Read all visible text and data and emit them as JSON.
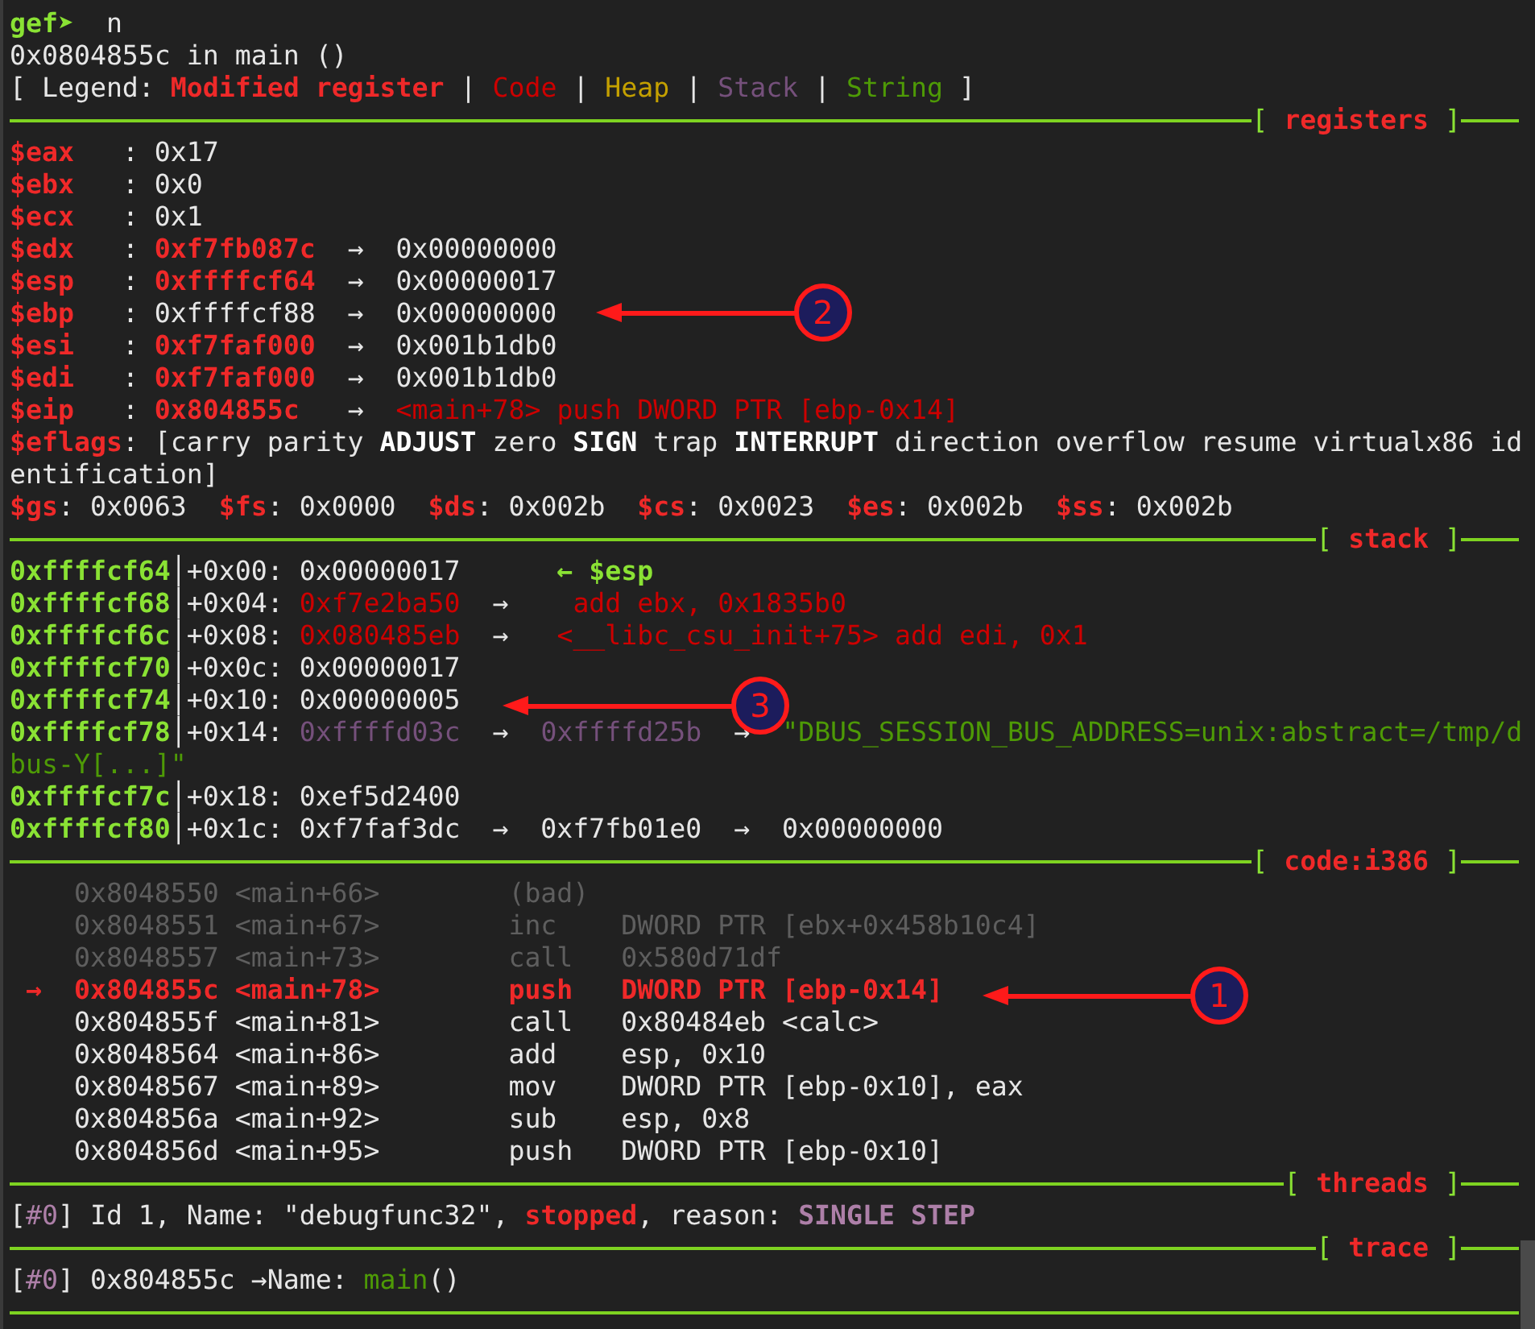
{
  "lines": [
    {
      "kind": "text",
      "segments": [
        {
          "text": "gef➤",
          "kind": "prompt"
        },
        {
          "text": "  n",
          "kind": "plain"
        }
      ]
    },
    {
      "kind": "text",
      "segments": [
        {
          "text": "0x0804855c in main ()",
          "kind": "plain"
        }
      ]
    },
    {
      "kind": "text",
      "segments": [
        {
          "text": "[ Legend:",
          "kind": "plain"
        },
        {
          "text": " Modified register",
          "kind": "mod"
        },
        {
          "text": " |",
          "kind": "plain"
        },
        {
          "text": " Code",
          "kind": "code"
        },
        {
          "text": " |",
          "kind": "plain"
        },
        {
          "text": " Heap",
          "kind": "heap"
        },
        {
          "text": " |",
          "kind": "plain"
        },
        {
          "text": " Stack",
          "kind": "stack"
        },
        {
          "text": " |",
          "kind": "plain"
        },
        {
          "text": " String",
          "kind": "string"
        },
        {
          "text": " ]",
          "kind": "plain"
        }
      ]
    },
    {
      "kind": "separator",
      "segments": [
        {
          "text": "[ ",
          "kind": "bracket"
        },
        {
          "text": "registers",
          "kind": "title"
        },
        {
          "text": " ]",
          "kind": "bracket"
        }
      ]
    },
    {
      "kind": "text",
      "segments": [
        {
          "text": "$eax",
          "kind": "mod"
        },
        {
          "text": "   : 0x17",
          "kind": "plain"
        }
      ]
    },
    {
      "kind": "text",
      "segments": [
        {
          "text": "$ebx",
          "kind": "mod"
        },
        {
          "text": "   : 0x0",
          "kind": "plain"
        }
      ]
    },
    {
      "kind": "text",
      "segments": [
        {
          "text": "$ecx",
          "kind": "mod"
        },
        {
          "text": "   : 0x1",
          "kind": "plain"
        }
      ]
    },
    {
      "kind": "text",
      "segments": [
        {
          "text": "$edx",
          "kind": "mod"
        },
        {
          "text": "   :",
          "kind": "plain"
        },
        {
          "text": " 0xf7fb087c",
          "kind": "mod"
        },
        {
          "text": "  →  0x00000000",
          "kind": "plain"
        }
      ]
    },
    {
      "kind": "text",
      "segments": [
        {
          "text": "$esp",
          "kind": "mod"
        },
        {
          "text": "   :",
          "kind": "plain"
        },
        {
          "text": " 0xffffcf64",
          "kind": "mod"
        },
        {
          "text": "  →  0x00000017",
          "kind": "plain"
        }
      ]
    },
    {
      "kind": "text",
      "segments": [
        {
          "text": "$ebp",
          "kind": "mod"
        },
        {
          "text": "   : 0xffffcf88  →  0x00000000",
          "kind": "plain"
        }
      ]
    },
    {
      "kind": "text",
      "segments": [
        {
          "text": "$esi",
          "kind": "mod"
        },
        {
          "text": "   :",
          "kind": "plain"
        },
        {
          "text": " 0xf7faf000",
          "kind": "mod"
        },
        {
          "text": "  →  0x001b1db0",
          "kind": "plain"
        }
      ]
    },
    {
      "kind": "text",
      "segments": [
        {
          "text": "$edi",
          "kind": "mod"
        },
        {
          "text": "   :",
          "kind": "plain"
        },
        {
          "text": " 0xf7faf000",
          "kind": "mod"
        },
        {
          "text": "  →  0x001b1db0",
          "kind": "plain"
        }
      ]
    },
    {
      "kind": "text",
      "segments": [
        {
          "text": "$eip",
          "kind": "mod"
        },
        {
          "text": "   :",
          "kind": "plain"
        },
        {
          "text": " 0x804855c",
          "kind": "mod"
        },
        {
          "text": "   →",
          "kind": "plain"
        },
        {
          "text": "  <main+78> push DWORD PTR [ebp-0x14]",
          "kind": "code"
        }
      ]
    },
    {
      "kind": "text",
      "segments": [
        {
          "text": "$eflags",
          "kind": "mod"
        },
        {
          "text": ": [carry parity",
          "kind": "plain"
        },
        {
          "text": " ADJUST",
          "kind": "bold"
        },
        {
          "text": " zero",
          "kind": "plain"
        },
        {
          "text": " SIGN",
          "kind": "bold"
        },
        {
          "text": " trap",
          "kind": "plain"
        },
        {
          "text": " INTERRUPT",
          "kind": "bold"
        },
        {
          "text": " direction overflow resume virtualx86 id",
          "kind": "plain"
        }
      ]
    },
    {
      "kind": "text",
      "segments": [
        {
          "text": "entification]",
          "kind": "plain"
        }
      ]
    },
    {
      "kind": "text",
      "segments": [
        {
          "text": "$gs",
          "kind": "mod"
        },
        {
          "text": ": 0x0063  ",
          "kind": "plain"
        },
        {
          "text": "$fs",
          "kind": "mod"
        },
        {
          "text": ": 0x0000  ",
          "kind": "plain"
        },
        {
          "text": "$ds",
          "kind": "mod"
        },
        {
          "text": ": 0x002b  ",
          "kind": "plain"
        },
        {
          "text": "$cs",
          "kind": "mod"
        },
        {
          "text": ": 0x0023  ",
          "kind": "plain"
        },
        {
          "text": "$es",
          "kind": "mod"
        },
        {
          "text": ": 0x002b  ",
          "kind": "plain"
        },
        {
          "text": "$ss",
          "kind": "mod"
        },
        {
          "text": ": 0x002b",
          "kind": "plain"
        }
      ]
    },
    {
      "kind": "separator",
      "segments": [
        {
          "text": "[ ",
          "kind": "bracket"
        },
        {
          "text": "stack",
          "kind": "title"
        },
        {
          "text": " ]",
          "kind": "bracket"
        }
      ]
    },
    {
      "kind": "text",
      "segments": [
        {
          "text": "0xffffcf64",
          "kind": "addr"
        },
        {
          "text": "│+0x00: 0x00000017     ",
          "kind": "plain"
        },
        {
          "text": " ← $esp",
          "kind": "addr"
        }
      ]
    },
    {
      "kind": "text",
      "segments": [
        {
          "text": "0xffffcf68",
          "kind": "addr"
        },
        {
          "text": "│+0x04:",
          "kind": "plain"
        },
        {
          "text": " 0xf7e2ba50",
          "kind": "code"
        },
        {
          "text": "  →",
          "kind": "plain"
        },
        {
          "text": "    add ebx, 0x1835b0",
          "kind": "code"
        }
      ]
    },
    {
      "kind": "text",
      "segments": [
        {
          "text": "0xffffcf6c",
          "kind": "addr"
        },
        {
          "text": "│+0x08:",
          "kind": "plain"
        },
        {
          "text": " 0x080485eb",
          "kind": "code"
        },
        {
          "text": "  →",
          "kind": "plain"
        },
        {
          "text": "   <__libc_csu_init+75> add edi, 0x1",
          "kind": "code"
        }
      ]
    },
    {
      "kind": "text",
      "segments": [
        {
          "text": "0xffffcf70",
          "kind": "addr"
        },
        {
          "text": "│+0x0c: 0x00000017",
          "kind": "plain"
        }
      ]
    },
    {
      "kind": "text",
      "segments": [
        {
          "text": "0xffffcf74",
          "kind": "addr"
        },
        {
          "text": "│+0x10: 0x00000005",
          "kind": "plain"
        }
      ]
    },
    {
      "kind": "text",
      "segments": [
        {
          "text": "0xffffcf78",
          "kind": "addr"
        },
        {
          "text": "│+0x14:",
          "kind": "plain"
        },
        {
          "text": " 0xffffd03c",
          "kind": "stack"
        },
        {
          "text": "  →",
          "kind": "plain"
        },
        {
          "text": "  0xffffd25b",
          "kind": "stack"
        },
        {
          "text": "  →",
          "kind": "plain"
        },
        {
          "text": "  \"DBUS_SESSION_BUS_ADDRESS=unix:abstract=/tmp/d",
          "kind": "string"
        }
      ]
    },
    {
      "kind": "text",
      "segments": [
        {
          "text": "bus-Y[...]\"",
          "kind": "string"
        }
      ]
    },
    {
      "kind": "text",
      "segments": [
        {
          "text": "0xffffcf7c",
          "kind": "addr"
        },
        {
          "text": "│+0x18: 0xef5d2400",
          "kind": "plain"
        }
      ]
    },
    {
      "kind": "text",
      "segments": [
        {
          "text": "0xffffcf80",
          "kind": "addr"
        },
        {
          "text": "│+0x1c: 0xf7faf3dc  →  0xf7fb01e0  →  0x00000000",
          "kind": "plain"
        }
      ]
    },
    {
      "kind": "separator",
      "segments": [
        {
          "text": "[ ",
          "kind": "bracket"
        },
        {
          "text": "code:i386",
          "kind": "title"
        },
        {
          "text": " ]",
          "kind": "bracket"
        }
      ]
    },
    {
      "kind": "text",
      "segments": [
        {
          "text": "    0x8048550 <main+66>        (bad)",
          "kind": "dim"
        }
      ]
    },
    {
      "kind": "text",
      "segments": [
        {
          "text": "    0x8048551 <main+67>        inc    DWORD PTR [ebx+0x458b10c4]",
          "kind": "dim"
        }
      ]
    },
    {
      "kind": "text",
      "segments": [
        {
          "text": "    0x8048557 <main+73>        call   0x580d71df",
          "kind": "dim"
        }
      ]
    },
    {
      "kind": "text",
      "segments": [
        {
          "text": " →  0x804855c <main+78>        push   DWORD PTR [ebp-0x14]",
          "kind": "current"
        }
      ]
    },
    {
      "kind": "text",
      "segments": [
        {
          "text": "    0x804855f <main+81>        call   0x80484eb <calc>",
          "kind": "plain"
        }
      ]
    },
    {
      "kind": "text",
      "segments": [
        {
          "text": "    0x8048564 <main+86>        add    esp, 0x10",
          "kind": "plain"
        }
      ]
    },
    {
      "kind": "text",
      "segments": [
        {
          "text": "    0x8048567 <main+89>        mov    DWORD PTR [ebp-0x10], eax",
          "kind": "plain"
        }
      ]
    },
    {
      "kind": "text",
      "segments": [
        {
          "text": "    0x804856a <main+92>        sub    esp, 0x8",
          "kind": "plain"
        }
      ]
    },
    {
      "kind": "text",
      "segments": [
        {
          "text": "    0x804856d <main+95>        push   DWORD PTR [ebp-0x10]",
          "kind": "plain"
        }
      ]
    },
    {
      "kind": "separator",
      "segments": [
        {
          "text": "[ ",
          "kind": "bracket"
        },
        {
          "text": "threads",
          "kind": "title"
        },
        {
          "text": " ]",
          "kind": "bracket"
        }
      ]
    },
    {
      "kind": "text",
      "segments": [
        {
          "text": "[",
          "kind": "plain"
        },
        {
          "text": "#0",
          "kind": "thread"
        },
        {
          "text": "] Id 1, Name: \"debugfunc32\",",
          "kind": "plain"
        },
        {
          "text": " stopped",
          "kind": "mod"
        },
        {
          "text": ", reason:",
          "kind": "plain"
        },
        {
          "text": " SINGLE STEP",
          "kind": "reason"
        }
      ]
    },
    {
      "kind": "separator",
      "segments": [
        {
          "text": "[ ",
          "kind": "bracket"
        },
        {
          "text": "trace",
          "kind": "title"
        },
        {
          "text": " ]",
          "kind": "bracket"
        }
      ]
    },
    {
      "kind": "text",
      "segments": [
        {
          "text": "[",
          "kind": "plain"
        },
        {
          "text": "#0",
          "kind": "thread"
        },
        {
          "text": "] 0x804855c →Name:",
          "kind": "plain"
        },
        {
          "text": " main",
          "kind": "string"
        },
        {
          "text": "()",
          "kind": "plain"
        }
      ]
    },
    {
      "kind": "rule"
    }
  ],
  "annotations": [
    {
      "number": "2"
    },
    {
      "number": "3"
    },
    {
      "number": "1"
    }
  ]
}
